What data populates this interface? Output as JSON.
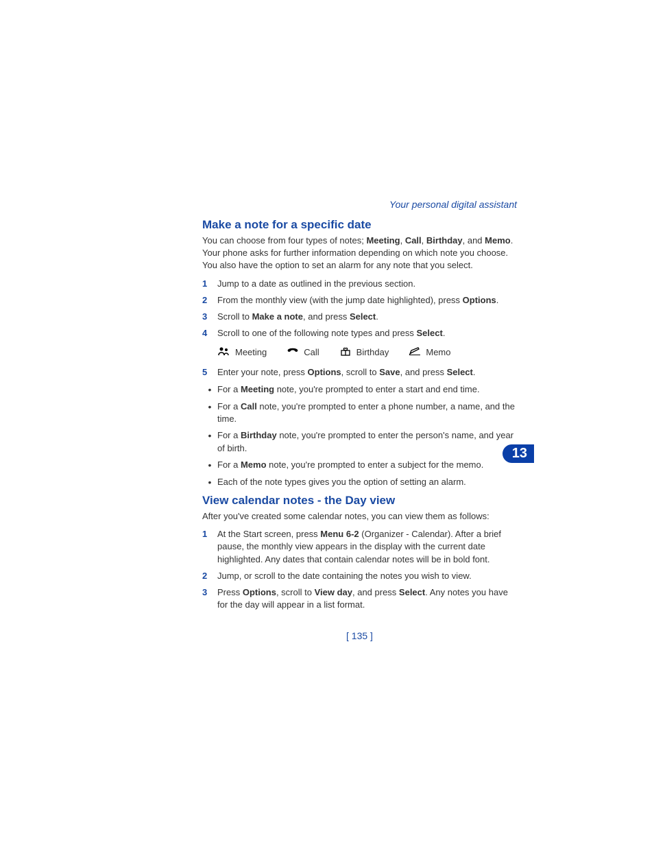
{
  "header": {
    "title": "Your personal digital assistant"
  },
  "chapter": {
    "number": "13"
  },
  "section1": {
    "heading": "Make a note for a specific date",
    "intro": {
      "part1": "You can choose from four types of notes; ",
      "b1": "Meeting",
      "c1": ", ",
      "b2": "Call",
      "c2": ", ",
      "b3": "Birthday",
      "c3": ", and ",
      "b4": "Memo",
      "part2": ". Your phone asks for further information depending on which note you choose. You also have the option to set an alarm for any note that you select."
    },
    "steps": [
      {
        "n": "1",
        "text": "Jump to a date as outlined in the previous section."
      },
      {
        "n": "2",
        "pre": "From the monthly view (with the jump date highlighted), press ",
        "bold": "Options",
        "post": "."
      },
      {
        "n": "3",
        "segments": [
          "Scroll to ",
          "Make a note",
          ", and press ",
          "Select",
          "."
        ]
      },
      {
        "n": "4",
        "segments": [
          "Scroll to one of the following note types and press ",
          "Select",
          "."
        ]
      },
      {
        "n": "5",
        "segments": [
          "Enter your note, press ",
          "Options",
          ", scroll to ",
          "Save",
          ", and press ",
          "Select",
          "."
        ]
      }
    ],
    "icons": {
      "meeting": "Meeting",
      "call": "Call",
      "birthday": "Birthday",
      "memo": "Memo"
    },
    "bullets": [
      {
        "pre": "For a ",
        "bold": "Meeting",
        "post": " note, you're prompted to enter a start and end time."
      },
      {
        "pre": "For a ",
        "bold": "Call",
        "post": " note, you're prompted to enter a phone number, a name, and the time."
      },
      {
        "pre": "For a ",
        "bold": "Birthday",
        "post": " note, you're prompted to enter the person's name, and year of birth."
      },
      {
        "pre": "For a ",
        "bold": "Memo",
        "post": " note, you're prompted to enter a subject for the memo."
      },
      {
        "plain": "Each of the note types gives you the option of setting an alarm."
      }
    ]
  },
  "section2": {
    "heading": "View calendar notes - the Day view",
    "intro": "After you've created some calendar notes, you can view them as follows:",
    "steps": [
      {
        "n": "1",
        "segments": [
          "At the Start screen, press ",
          "Menu 6-2",
          " (Organizer - Calendar). After a brief pause, the monthly view appears in the display with the current date highlighted. Any dates that contain calendar notes will be in bold font."
        ]
      },
      {
        "n": "2",
        "plain": "Jump, or scroll to the date containing the notes you wish to view."
      },
      {
        "n": "3",
        "segments": [
          "Press ",
          "Options",
          ", scroll to ",
          "View day",
          ", and press ",
          "Select",
          ". Any notes you have for the day will appear in a list format."
        ]
      }
    ]
  },
  "pageNumber": "[ 135 ]"
}
